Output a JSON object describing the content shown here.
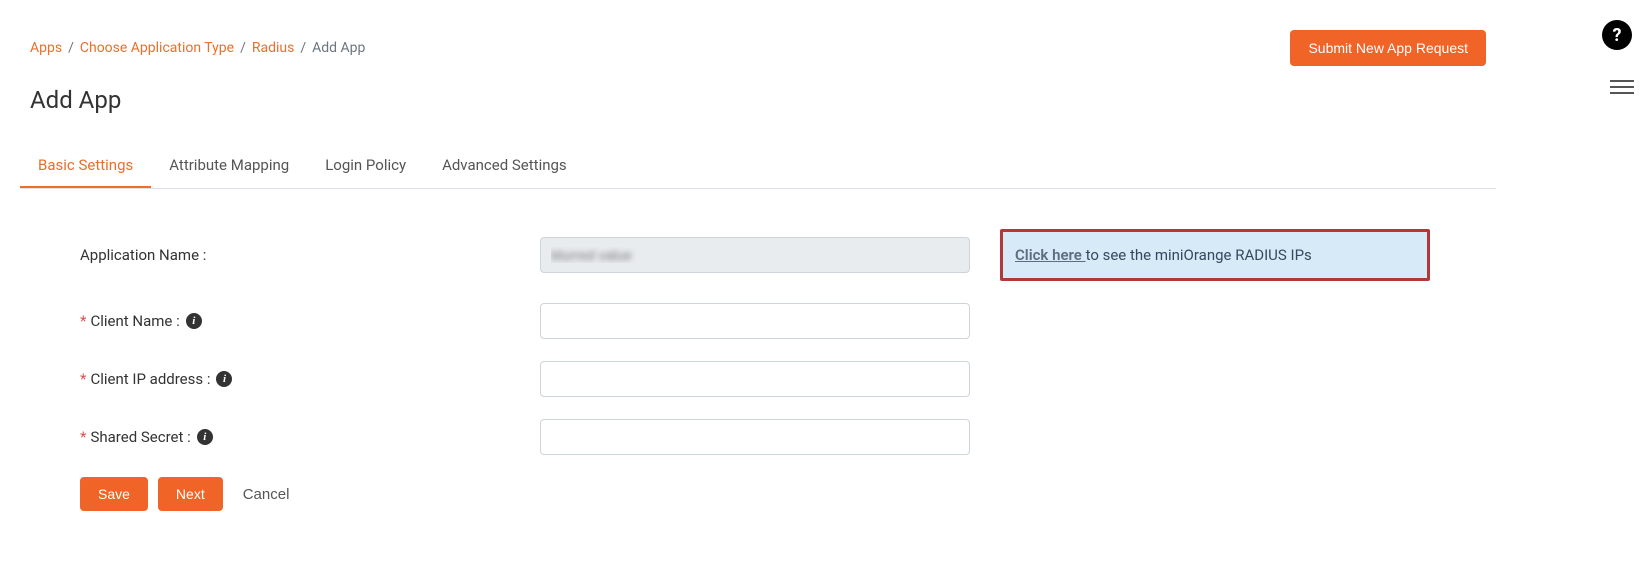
{
  "breadcrumb": {
    "items": [
      {
        "label": "Apps"
      },
      {
        "label": "Choose Application Type"
      },
      {
        "label": "Radius"
      }
    ],
    "current": "Add App"
  },
  "header": {
    "submit_btn": "Submit New App Request",
    "page_title": "Add App"
  },
  "tabs": [
    {
      "label": "Basic Settings",
      "active": true
    },
    {
      "label": "Attribute Mapping",
      "active": false
    },
    {
      "label": "Login Policy",
      "active": false
    },
    {
      "label": "Advanced Settings",
      "active": false
    }
  ],
  "form": {
    "app_name": {
      "label": "Application Name :",
      "value": "blurred value"
    },
    "client_name": {
      "label": "Client Name :",
      "value": ""
    },
    "client_ip": {
      "label": "Client IP address :",
      "value": ""
    },
    "shared_secret": {
      "label": "Shared Secret :",
      "value": ""
    }
  },
  "callout": {
    "link_text": "Click here ",
    "rest_text": "to see the miniOrange RADIUS IPs"
  },
  "buttons": {
    "save": "Save",
    "next": "Next",
    "cancel": "Cancel"
  }
}
